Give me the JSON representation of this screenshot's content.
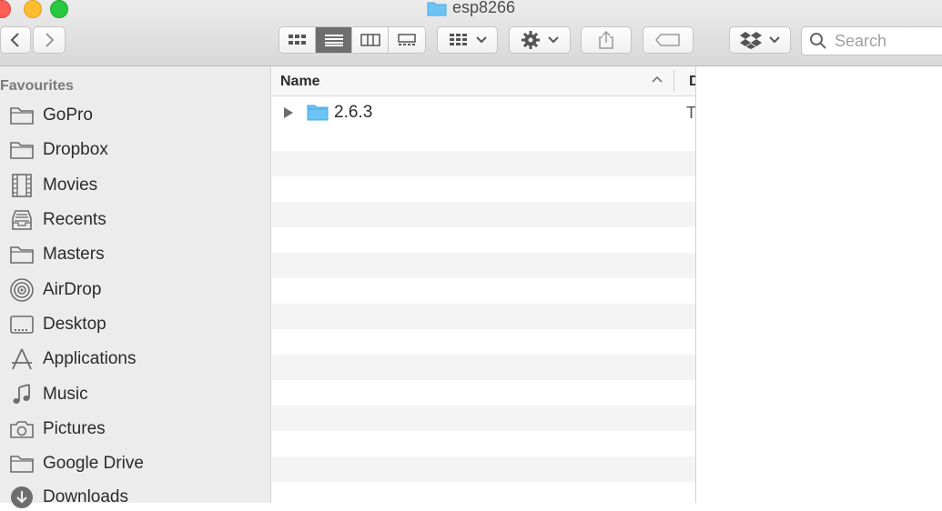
{
  "window": {
    "title": "esp8266"
  },
  "toolbar": {
    "back_icon": "chevron-left-icon",
    "forward_icon": "chevron-right-icon",
    "view_icons": [
      "icon-view-icon",
      "list-view-icon",
      "column-view-icon",
      "gallery-view-icon"
    ],
    "active_view": "list",
    "arrange_icon": "arrange-icon",
    "action_icon": "gear-icon",
    "share_icon": "share-icon",
    "tag_icon": "tag-icon",
    "dropbox_icon": "dropbox-icon"
  },
  "search": {
    "placeholder": "Search"
  },
  "sidebar": {
    "heading": "Favourites",
    "items": [
      {
        "label": "GoPro",
        "icon": "folder-icon"
      },
      {
        "label": "Dropbox",
        "icon": "folder-icon"
      },
      {
        "label": "Movies",
        "icon": "film-icon"
      },
      {
        "label": "Recents",
        "icon": "recents-icon"
      },
      {
        "label": "Masters",
        "icon": "folder-icon"
      },
      {
        "label": "AirDrop",
        "icon": "airdrop-icon"
      },
      {
        "label": "Desktop",
        "icon": "desktop-icon"
      },
      {
        "label": "Applications",
        "icon": "applications-icon"
      },
      {
        "label": "Music",
        "icon": "music-icon"
      },
      {
        "label": "Pictures",
        "icon": "camera-icon"
      },
      {
        "label": "Google Drive",
        "icon": "folder-icon"
      },
      {
        "label": "Downloads",
        "icon": "downloads-icon"
      }
    ]
  },
  "list": {
    "columns": {
      "name": "Name",
      "next": "D"
    },
    "rows": [
      {
        "name": "2.6.3",
        "kind": "T"
      }
    ]
  },
  "colors": {
    "folder_blue": "#6cc4f5",
    "sidebar_bg": "#ececec",
    "alt_row": "#f4f4f4"
  }
}
